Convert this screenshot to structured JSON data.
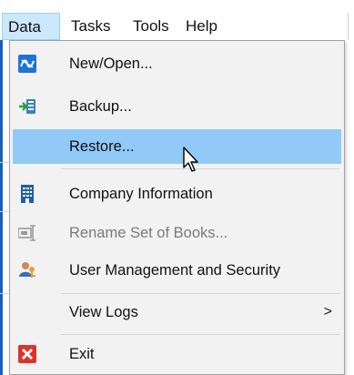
{
  "menubar": {
    "items": [
      {
        "label": "Data",
        "active": true
      },
      {
        "label": "Tasks",
        "active": false
      },
      {
        "label": "Tools",
        "active": false
      },
      {
        "label": "Help",
        "active": false
      }
    ]
  },
  "dropdown": {
    "items": [
      {
        "label": "New/Open...",
        "icon": "new-open-icon",
        "enabled": true
      },
      {
        "label": "Backup...",
        "icon": "backup-icon",
        "enabled": true
      },
      {
        "label": "Restore...",
        "icon": "",
        "enabled": true,
        "hovered": true
      },
      {
        "label": "Company Information",
        "icon": "company-building-icon",
        "enabled": true
      },
      {
        "label": "Rename Set of Books...",
        "icon": "rename-icon",
        "enabled": false
      },
      {
        "label": "User Management and Security",
        "icon": "users-security-icon",
        "enabled": true
      },
      {
        "label": "View Logs",
        "icon": "",
        "enabled": true,
        "submenu": true
      },
      {
        "label": "Exit",
        "icon": "exit-icon",
        "enabled": true
      }
    ],
    "submenu_arrow": ">"
  },
  "colors": {
    "hover": "#91c9f7",
    "menubar_active": "#cce8ff",
    "exit_red": "#d9352c",
    "new_open_blue": "#1e73d8"
  }
}
